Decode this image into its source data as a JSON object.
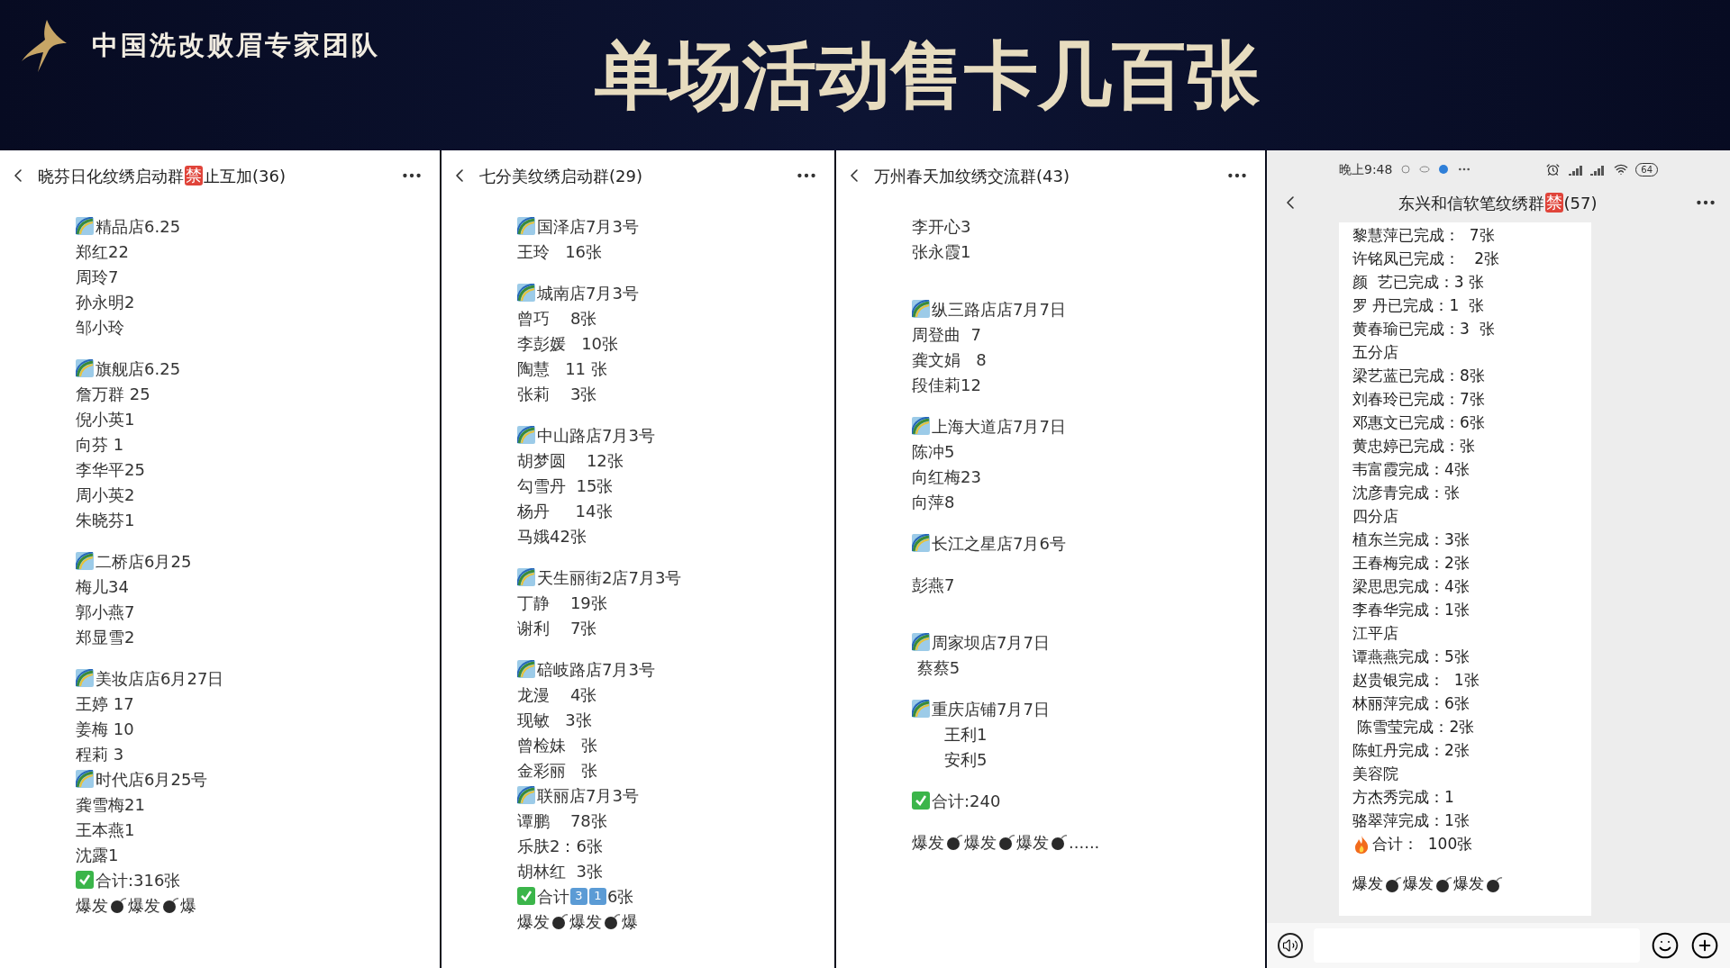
{
  "slide": {
    "brand": "中国洗改败眉专家团队",
    "title": "单场活动售卡几百张"
  },
  "panels": [
    {
      "kind": "chat",
      "title": {
        "before": "晓芬日化纹绣启动群",
        "badge": "禁",
        "after": "止互加(36)"
      },
      "lines": [
        {
          "kind": "store",
          "text": "精品店6.25"
        },
        {
          "kind": "name",
          "text": "郑红22"
        },
        {
          "kind": "name",
          "text": "周玲7"
        },
        {
          "kind": "name",
          "text": "孙永明2"
        },
        {
          "kind": "name",
          "text": "邹小玲"
        },
        {
          "kind": "gap"
        },
        {
          "kind": "store",
          "text": "旗舰店6.25"
        },
        {
          "kind": "name",
          "text": "詹万群 25"
        },
        {
          "kind": "name",
          "text": "倪小英1"
        },
        {
          "kind": "name",
          "text": "向芬 1"
        },
        {
          "kind": "name",
          "text": "李华平25"
        },
        {
          "kind": "name",
          "text": "周小英2"
        },
        {
          "kind": "name",
          "text": "朱晓芬1"
        },
        {
          "kind": "gap"
        },
        {
          "kind": "store",
          "text": "二桥店6月25"
        },
        {
          "kind": "name",
          "text": "梅儿34"
        },
        {
          "kind": "name",
          "text": "郭小燕7"
        },
        {
          "kind": "name",
          "text": "郑显雪2"
        },
        {
          "kind": "gap"
        },
        {
          "kind": "store",
          "text": "美妆店店6月27日"
        },
        {
          "kind": "name",
          "text": "王婷 17"
        },
        {
          "kind": "name",
          "text": "姜梅 10"
        },
        {
          "kind": "name",
          "text": "程莉 3"
        },
        {
          "kind": "store",
          "text": "时代店6月25号"
        },
        {
          "kind": "name",
          "text": "龚雪梅21"
        },
        {
          "kind": "name",
          "text": "王本燕1"
        },
        {
          "kind": "name",
          "text": "沈露1"
        },
        {
          "kind": "total",
          "segments": [
            {
              "kind": "text",
              "text": "合计:316张"
            }
          ]
        },
        {
          "kind": "bombs",
          "parts": [
            {
              "kind": "text",
              "text": "爆发"
            },
            {
              "kind": "bomb"
            },
            {
              "kind": "text",
              "text": "爆发"
            },
            {
              "kind": "bomb"
            },
            {
              "kind": "text",
              "text": "爆"
            }
          ]
        }
      ]
    },
    {
      "kind": "chat",
      "title": {
        "before": "七分美纹绣启动群(29)"
      },
      "lines": [
        {
          "kind": "store",
          "text": "国泽店7月3号"
        },
        {
          "kind": "name",
          "text": "王玲   16张"
        },
        {
          "kind": "gap"
        },
        {
          "kind": "store",
          "text": "城南店7月3号"
        },
        {
          "kind": "name",
          "text": "曾巧    8张"
        },
        {
          "kind": "name",
          "text": "李彭媛   10张"
        },
        {
          "kind": "name",
          "text": "陶慧   11 张"
        },
        {
          "kind": "name",
          "text": "张莉    3张"
        },
        {
          "kind": "gap"
        },
        {
          "kind": "store",
          "text": "中山路店7月3号"
        },
        {
          "kind": "name",
          "text": "胡梦圆    12张"
        },
        {
          "kind": "name",
          "text": "勾雪丹  15张"
        },
        {
          "kind": "name",
          "text": "杨丹     14张"
        },
        {
          "kind": "name",
          "text": "马娥42张"
        },
        {
          "kind": "gap"
        },
        {
          "kind": "store",
          "text": "天生丽街2店7月3号"
        },
        {
          "kind": "name",
          "text": "丁静    19张"
        },
        {
          "kind": "name",
          "text": "谢利    7张"
        },
        {
          "kind": "gap"
        },
        {
          "kind": "store",
          "text": "碚岐路店7月3号"
        },
        {
          "kind": "name",
          "text": "龙漫    4张"
        },
        {
          "kind": "name",
          "text": "现敏   3张"
        },
        {
          "kind": "name",
          "text": "曾检妹   张"
        },
        {
          "kind": "name",
          "text": "金彩丽   张"
        },
        {
          "kind": "store",
          "text": "联丽店7月3号"
        },
        {
          "kind": "name",
          "text": "谭鹏    78张"
        },
        {
          "kind": "name",
          "text": "乐肤2：6张"
        },
        {
          "kind": "name",
          "text": "胡林红  3张"
        },
        {
          "kind": "total",
          "segments": [
            {
              "kind": "text",
              "text": "合计"
            },
            {
              "kind": "keycap",
              "text": "3"
            },
            {
              "kind": "keycap",
              "text": "1"
            },
            {
              "kind": "text",
              "text": "6张"
            }
          ]
        },
        {
          "kind": "bombs",
          "parts": [
            {
              "kind": "text",
              "text": "爆发"
            },
            {
              "kind": "bomb"
            },
            {
              "kind": "text",
              "text": "爆发"
            },
            {
              "kind": "bomb"
            },
            {
              "kind": "text",
              "text": "爆"
            }
          ]
        }
      ]
    },
    {
      "kind": "chat",
      "title": {
        "before": "万州春天加纹绣交流群(43)"
      },
      "lines": [
        {
          "kind": "name",
          "text": "李开心3"
        },
        {
          "kind": "name",
          "text": "张永霞1"
        },
        {
          "kind": "gap"
        },
        {
          "kind": "gap"
        },
        {
          "kind": "store",
          "text": "纵三路店店7月7日"
        },
        {
          "kind": "name",
          "text": "周登曲  7"
        },
        {
          "kind": "name",
          "text": "龚文娟   8"
        },
        {
          "kind": "name",
          "text": "段佳莉12"
        },
        {
          "kind": "gap"
        },
        {
          "kind": "store",
          "text": "上海大道店7月7日"
        },
        {
          "kind": "name",
          "text": "陈冲5"
        },
        {
          "kind": "name",
          "text": "向红梅23"
        },
        {
          "kind": "name",
          "text": "向萍8"
        },
        {
          "kind": "gap"
        },
        {
          "kind": "store",
          "text": "长江之星店7月6号"
        },
        {
          "kind": "gap"
        },
        {
          "kind": "name",
          "text": "彭燕7"
        },
        {
          "kind": "gap"
        },
        {
          "kind": "gap"
        },
        {
          "kind": "store",
          "text": "周家坝店7月7日"
        },
        {
          "kind": "name",
          "text": " 蔡蔡5"
        },
        {
          "kind": "gap"
        },
        {
          "kind": "store",
          "text": "重庆店铺7月7日"
        },
        {
          "kind": "sub",
          "text": "王利1"
        },
        {
          "kind": "sub",
          "text": "安利5"
        },
        {
          "kind": "gap"
        },
        {
          "kind": "total",
          "segments": [
            {
              "kind": "text",
              "text": "合计:240"
            }
          ]
        },
        {
          "kind": "gap"
        },
        {
          "kind": "bombs",
          "parts": [
            {
              "kind": "text",
              "text": "爆发"
            },
            {
              "kind": "bomb"
            },
            {
              "kind": "text",
              "text": "爆发"
            },
            {
              "kind": "bomb"
            },
            {
              "kind": "text",
              "text": "爆发"
            },
            {
              "kind": "bomb"
            },
            {
              "kind": "text",
              "text": "......"
            }
          ]
        }
      ]
    },
    {
      "kind": "phone",
      "status_bar": {
        "time": "晚上9:48",
        "battery": "64"
      },
      "title": {
        "before": "东兴和信软笔纹绣群",
        "badge": "禁",
        "after": "(57)"
      },
      "lines": [
        {
          "kind": "name",
          "text": "黎慧萍已完成：  7张"
        },
        {
          "kind": "name",
          "text": "许铭凤已完成：   2张"
        },
        {
          "kind": "name",
          "text": "颜  艺已完成：3 张"
        },
        {
          "kind": "name",
          "text": "罗 丹已完成：1  张"
        },
        {
          "kind": "name",
          "text": "黄春瑜已完成：3  张"
        },
        {
          "kind": "name",
          "text": "五分店"
        },
        {
          "kind": "name",
          "text": "梁艺蓝已完成：8张"
        },
        {
          "kind": "name",
          "text": "刘春玲已完成：7张"
        },
        {
          "kind": "name",
          "text": "邓惠文已完成：6张"
        },
        {
          "kind": "name",
          "text": "黄忠婷已完成：张"
        },
        {
          "kind": "name",
          "text": "韦富霞完成：4张"
        },
        {
          "kind": "name",
          "text": "沈彦青完成：张"
        },
        {
          "kind": "name",
          "text": "四分店"
        },
        {
          "kind": "name",
          "text": "植东兰完成：3张"
        },
        {
          "kind": "name",
          "text": "王春梅完成：2张"
        },
        {
          "kind": "name",
          "text": "梁思思完成：4张"
        },
        {
          "kind": "name",
          "text": "李春华完成：1张"
        },
        {
          "kind": "name",
          "text": "江平店"
        },
        {
          "kind": "name",
          "text": "谭燕燕完成：5张"
        },
        {
          "kind": "name",
          "text": "赵贵银完成：  1张"
        },
        {
          "kind": "name",
          "text": "林丽萍完成：6张"
        },
        {
          "kind": "name",
          "text": " 陈雪莹完成：2张"
        },
        {
          "kind": "name",
          "text": "陈虹丹完成：2张"
        },
        {
          "kind": "name",
          "text": "美容院"
        },
        {
          "kind": "name",
          "text": "方杰秀完成：1"
        },
        {
          "kind": "name",
          "text": "骆翠萍完成：1张"
        },
        {
          "kind": "fire_total",
          "text": "合计：  100张"
        },
        {
          "kind": "gap"
        },
        {
          "kind": "bombs",
          "parts": [
            {
              "kind": "text",
              "text": "爆发"
            },
            {
              "kind": "bomb"
            },
            {
              "kind": "text",
              "text": "爆发"
            },
            {
              "kind": "bomb"
            },
            {
              "kind": "text",
              "text": "爆发"
            },
            {
              "kind": "bomb"
            }
          ]
        }
      ]
    }
  ]
}
